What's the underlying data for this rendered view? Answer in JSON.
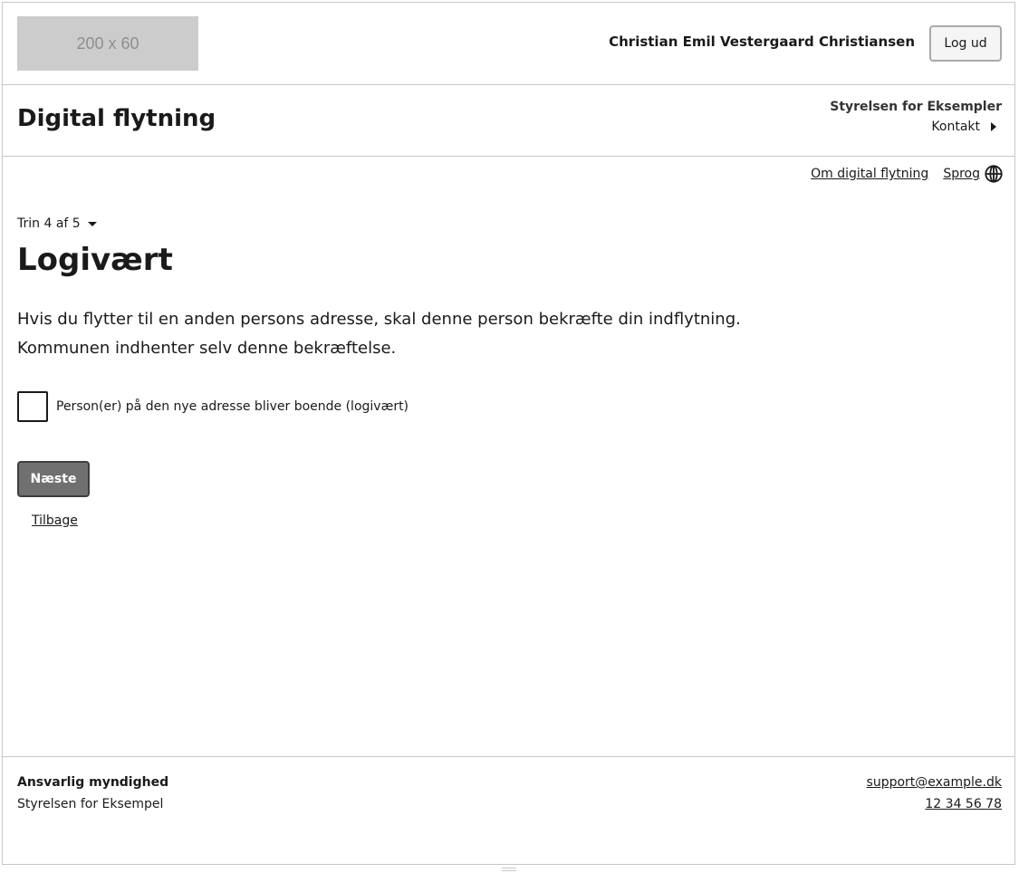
{
  "header": {
    "logo_placeholder": "200 x 60",
    "user_name": "Christian Emil Vestergaard Christiansen",
    "logout_label": "Log ud"
  },
  "subheader": {
    "site_title": "Digital flytning",
    "authority_name": "Styrelsen for Eksempler",
    "contact_label": "Kontakt",
    "contact_icon": "caret-right-icon"
  },
  "utility": {
    "about_label": "Om digital flytning",
    "language_label": "Sprog",
    "language_icon": "globe-icon"
  },
  "main": {
    "step_indicator": "Trin 4 af 5",
    "step_icon": "caret-down-icon",
    "title": "Logivært",
    "intro_line1": "Hvis du flytter til en anden persons adresse, skal denne person bekræfte din indflytning.",
    "intro_line2": "Kommunen indhenter selv denne bekræftelse.",
    "checkbox_label": "Person(er) på den nye adresse bliver boende (logivært)",
    "checkbox_checked": false,
    "next_label": "Næste",
    "back_label": "Tilbage"
  },
  "footer": {
    "heading": "Ansvarlig myndighed",
    "authority": "Styrelsen for Eksempel",
    "email": "support@example.dk",
    "phone": "12 34 56 78"
  },
  "colors": {
    "primary_button_bg": "#707070",
    "primary_button_border": "#3f3f3f",
    "logo_placeholder_bg": "#cccccc",
    "divider": "#c8c8c8",
    "text": "#1a1a1a"
  }
}
